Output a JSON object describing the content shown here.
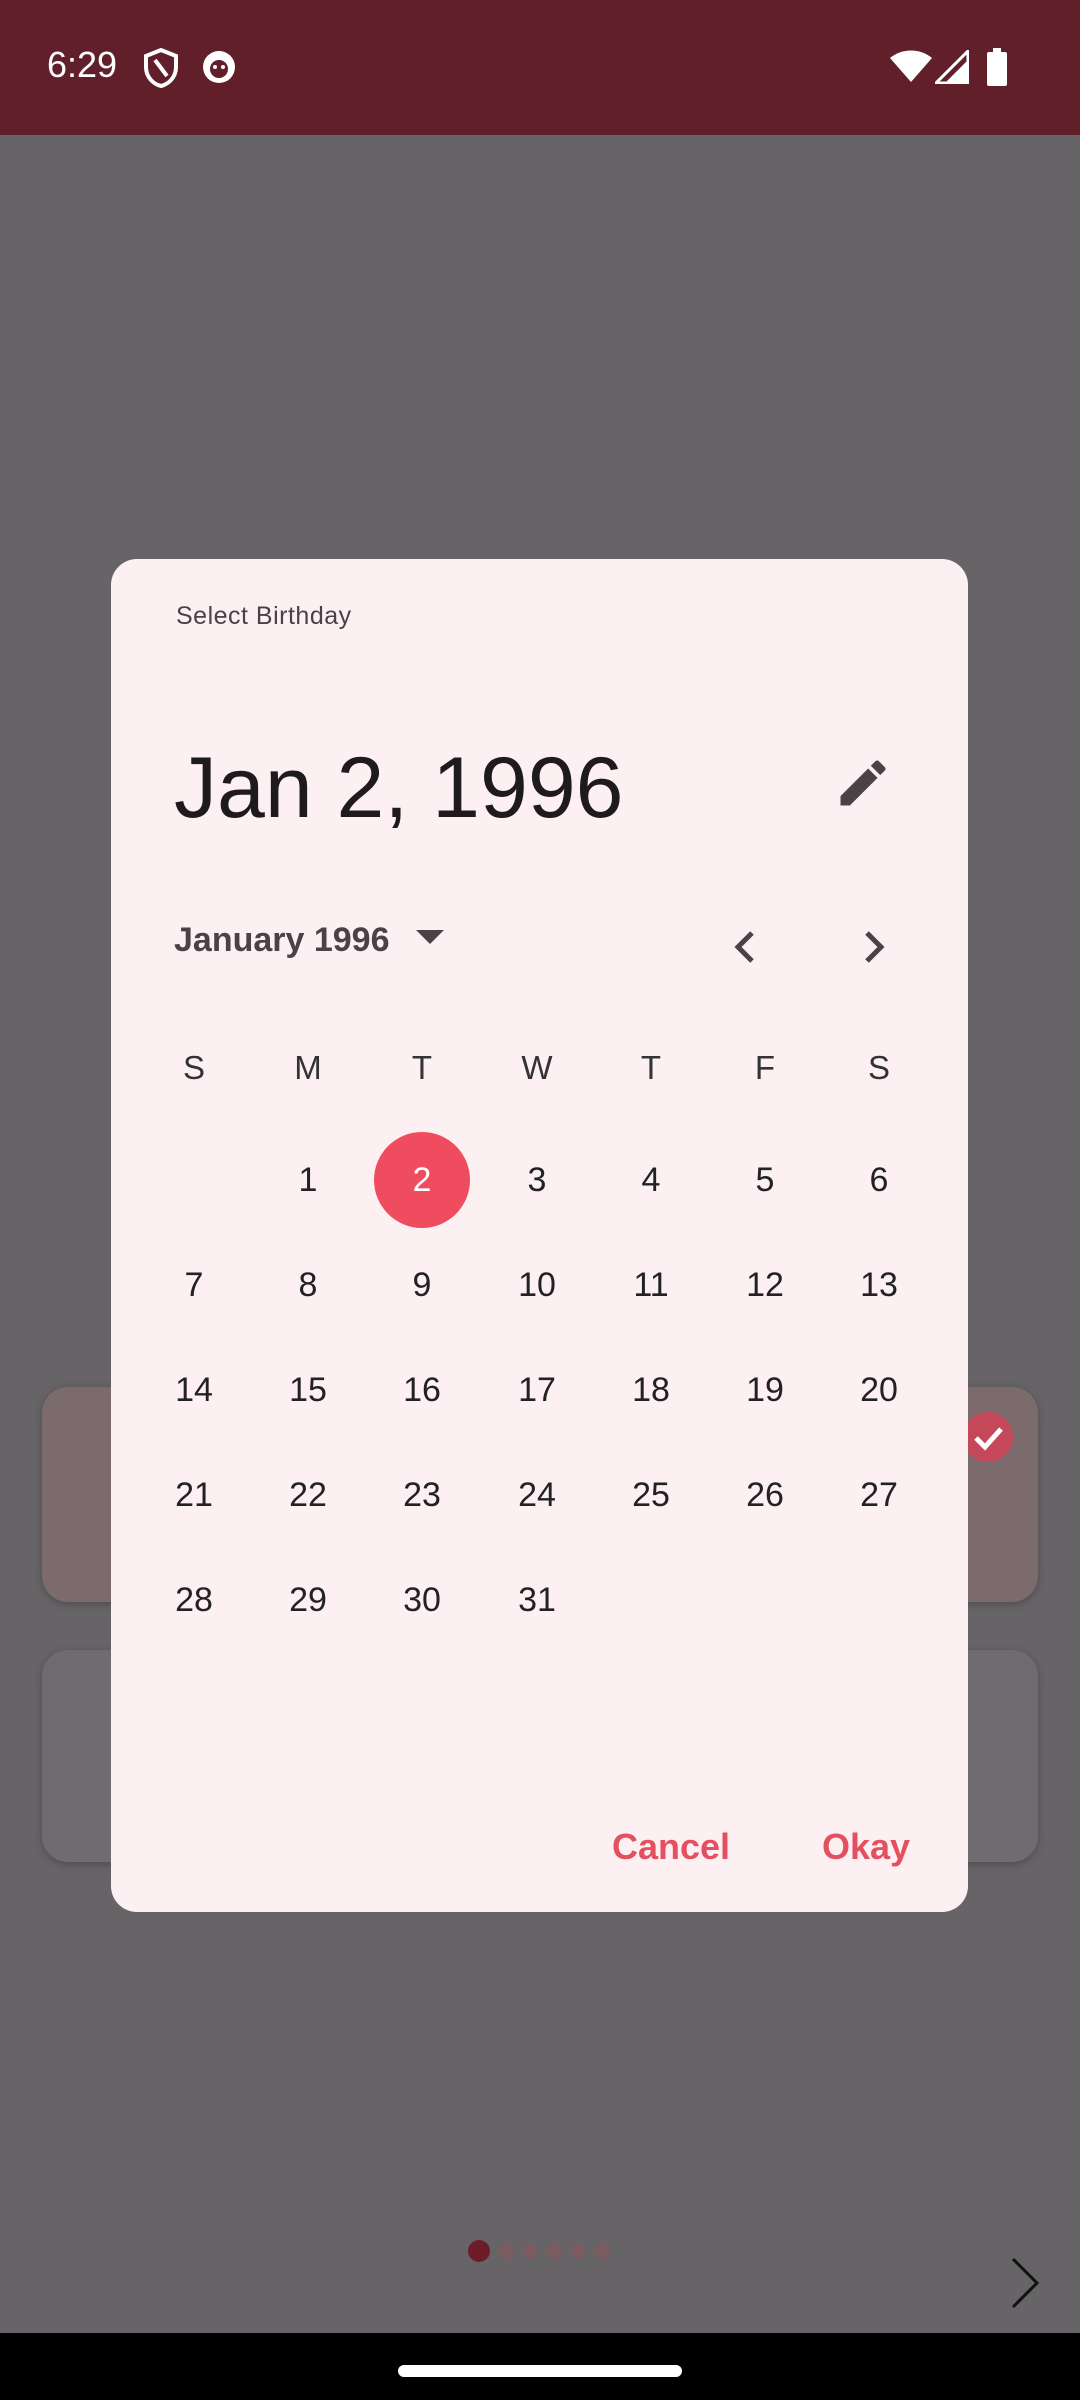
{
  "status_bar": {
    "time": "6:29"
  },
  "dialog": {
    "title": "Select Birthday",
    "selected_date": "Jan 2, 1996",
    "month_label": "January 1996",
    "weekdays": [
      "S",
      "M",
      "T",
      "W",
      "T",
      "F",
      "S"
    ],
    "days": [
      "1",
      "2",
      "3",
      "4",
      "5",
      "6",
      "7",
      "8",
      "9",
      "10",
      "11",
      "12",
      "13",
      "14",
      "15",
      "16",
      "17",
      "18",
      "19",
      "20",
      "21",
      "22",
      "23",
      "24",
      "25",
      "26",
      "27",
      "28",
      "29",
      "30",
      "31"
    ],
    "selected_day": "2",
    "cancel_label": "Cancel",
    "ok_label": "Okay"
  },
  "colors": {
    "accent": "#ef4d5f",
    "status_bar": "#611f2a",
    "dialog_bg": "#fdf0f3"
  },
  "pager": {
    "total": 6,
    "active": 1
  }
}
